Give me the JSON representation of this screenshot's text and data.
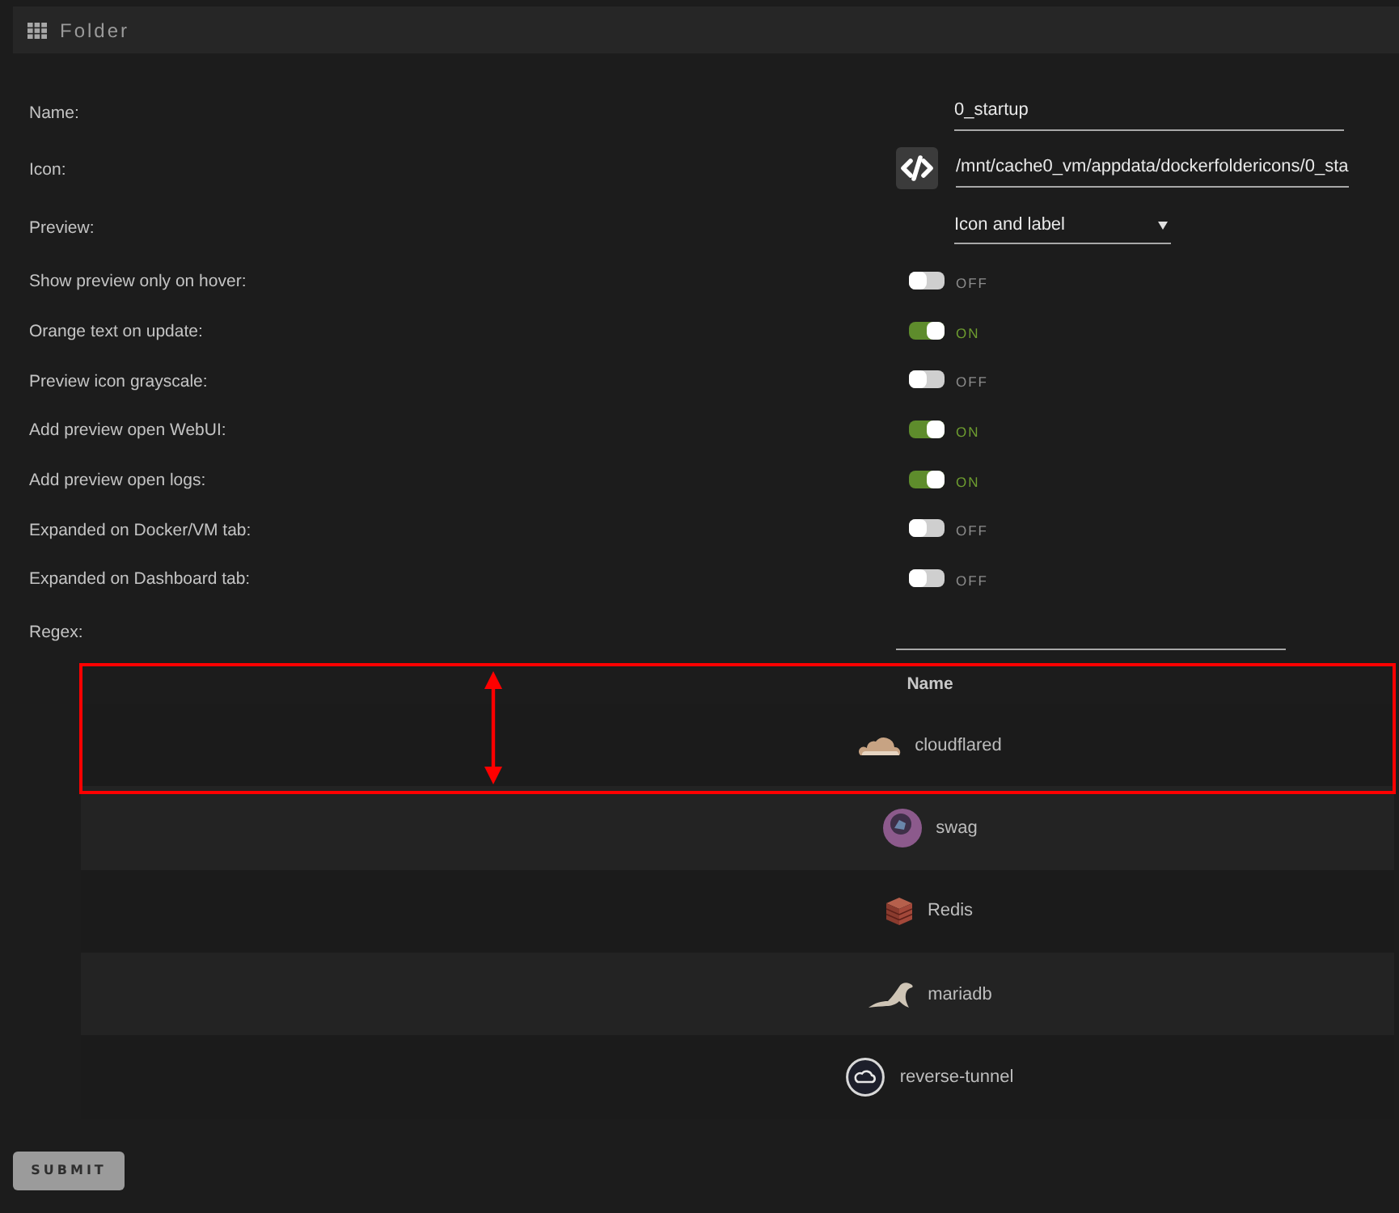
{
  "panel": {
    "title": "Folder"
  },
  "fields": [
    {
      "kind": "text",
      "label": "Name:",
      "value": "0_startup"
    },
    {
      "kind": "icon",
      "label": "Icon:",
      "value": "/mnt/cache0_vm/appdata/dockerfoldericons/0_sta"
    },
    {
      "kind": "select",
      "label": "Preview:",
      "value": "Icon and label"
    },
    {
      "kind": "toggle",
      "label": "Show preview only on hover:",
      "on": false,
      "state_text": "OFF"
    },
    {
      "kind": "toggle",
      "label": "Orange text on update:",
      "on": true,
      "state_text": "ON"
    },
    {
      "kind": "toggle",
      "label": "Preview icon grayscale:",
      "on": false,
      "state_text": "OFF"
    },
    {
      "kind": "toggle",
      "label": "Add preview open WebUI:",
      "on": true,
      "state_text": "ON"
    },
    {
      "kind": "toggle",
      "label": "Add preview open logs:",
      "on": true,
      "state_text": "ON"
    },
    {
      "kind": "toggle",
      "label": "Expanded on Docker/VM tab:",
      "on": false,
      "state_text": "OFF"
    },
    {
      "kind": "toggle",
      "label": "Expanded on Dashboard tab:",
      "on": false,
      "state_text": "OFF"
    },
    {
      "kind": "pattern",
      "label": "Regex:"
    }
  ],
  "table": {
    "columns": [
      "Name"
    ],
    "rows": [
      {
        "kind": "cloud",
        "name": "cloudflared"
      },
      {
        "kind": "sphere",
        "name": "swag"
      },
      {
        "kind": "cube",
        "name": "Redis"
      },
      {
        "kind": "seal",
        "name": "mariadb"
      },
      {
        "kind": "ring",
        "name": "reverse-tunnel"
      }
    ]
  },
  "submit": "SUBMIT"
}
